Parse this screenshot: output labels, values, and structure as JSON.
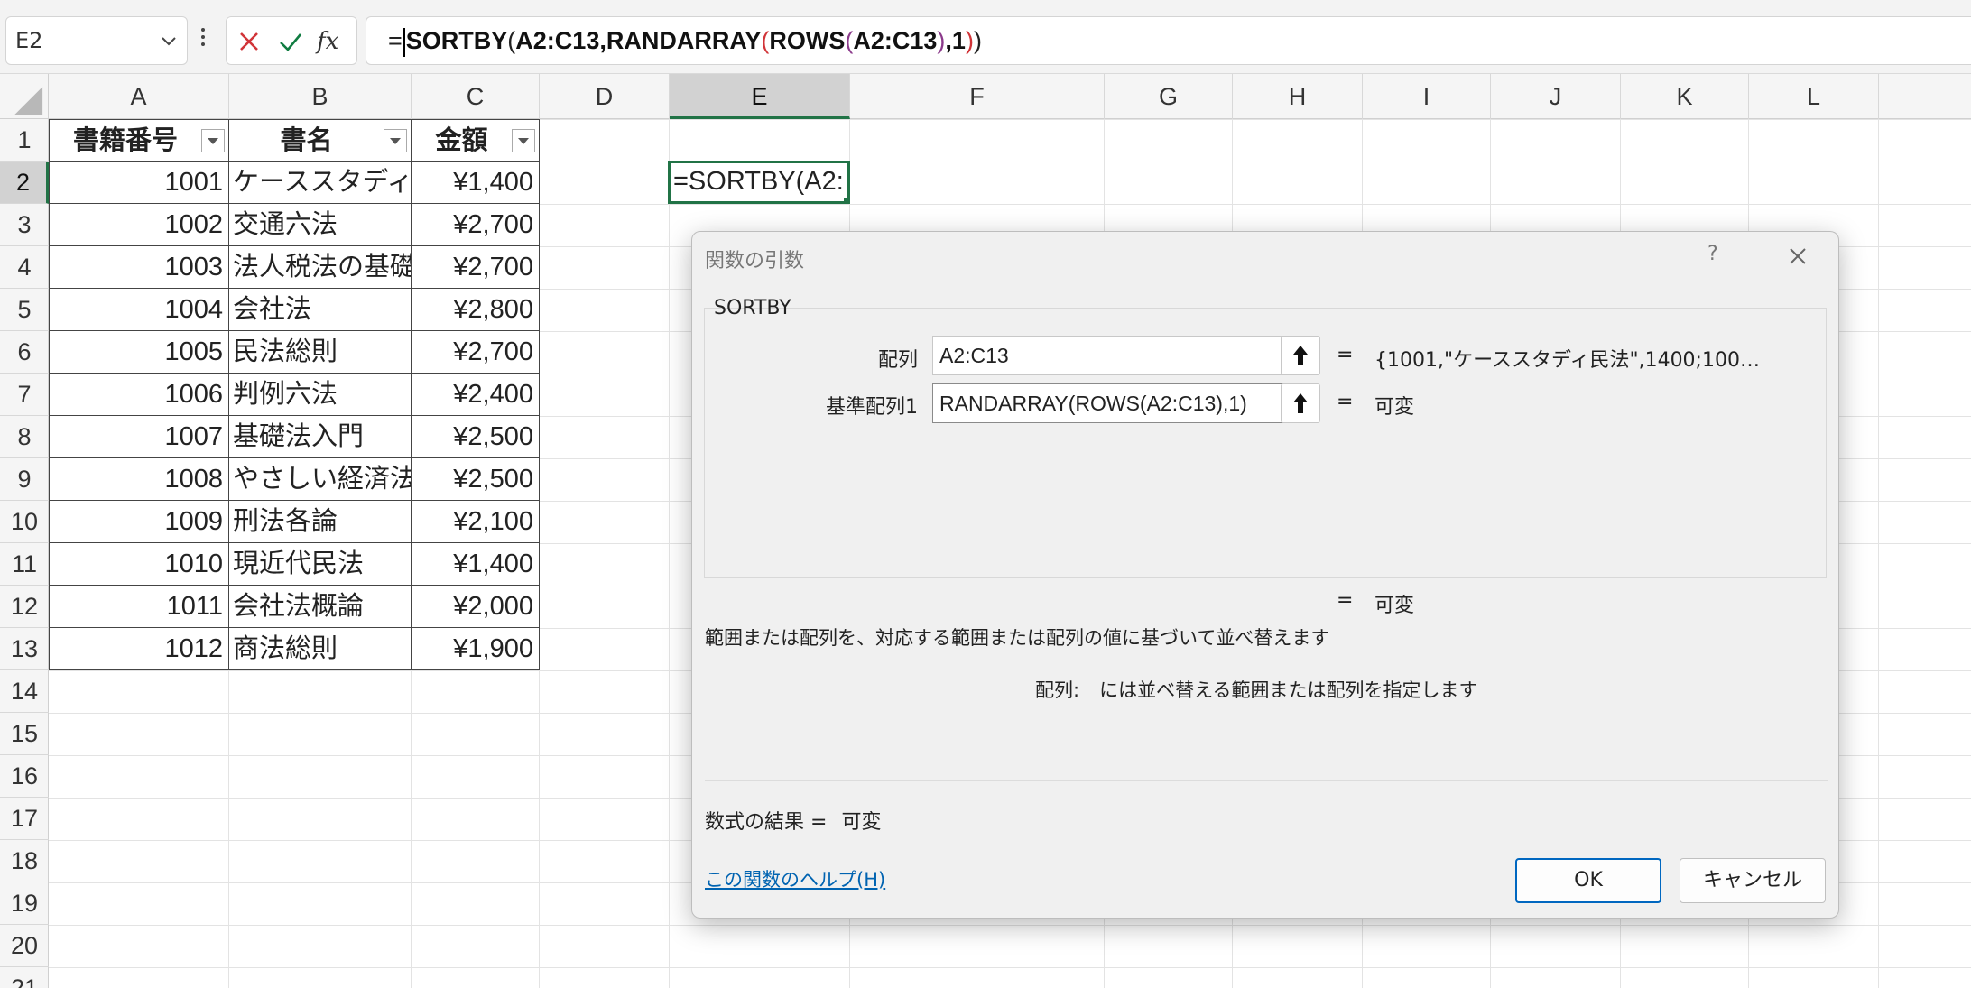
{
  "formula_bar": {
    "name_box": "E2",
    "formula_eq": "=",
    "formula_parts": [
      {
        "t": "SORTBY",
        "c": "f-strong"
      },
      {
        "t": "(",
        "c": ""
      },
      {
        "t": "A2:C13",
        "c": "f-strong"
      },
      {
        "t": ",RANDARRAY",
        "c": "f-strong"
      },
      {
        "t": "(",
        "c": "f-red"
      },
      {
        "t": "ROWS",
        "c": "f-strong"
      },
      {
        "t": "(",
        "c": "f-purple"
      },
      {
        "t": "A2:C13",
        "c": "f-strong"
      },
      {
        "t": ")",
        "c": "f-purple"
      },
      {
        "t": ",1",
        "c": "f-strong"
      },
      {
        "t": ")",
        "c": "f-red"
      },
      {
        "t": ")",
        "c": ""
      }
    ],
    "fx_label": "fx"
  },
  "grid": {
    "columns": [
      "A",
      "B",
      "C",
      "D",
      "E",
      "F",
      "G",
      "H",
      "I",
      "J",
      "K",
      "L"
    ],
    "selected_column": "E",
    "rows": [
      "1",
      "2",
      "3",
      "4",
      "5",
      "6",
      "7",
      "8",
      "9",
      "10",
      "11",
      "12",
      "13",
      "14",
      "15",
      "16",
      "17",
      "18",
      "19",
      "20",
      "21"
    ],
    "selected_row": "2",
    "table_headers": [
      "書籍番号",
      "書名",
      "金額"
    ],
    "table_rows": [
      [
        "1001",
        "ケーススタディ民法",
        "¥1,400"
      ],
      [
        "1002",
        "交通六法",
        "¥2,700"
      ],
      [
        "1003",
        "法人税法の基礎",
        "¥2,700"
      ],
      [
        "1004",
        "会社法",
        "¥2,800"
      ],
      [
        "1005",
        "民法総則",
        "¥2,700"
      ],
      [
        "1006",
        "判例六法",
        "¥2,400"
      ],
      [
        "1007",
        "基礎法入門",
        "¥2,500"
      ],
      [
        "1008",
        "やさしい経済法",
        "¥2,500"
      ],
      [
        "1009",
        "刑法各論",
        "¥2,100"
      ],
      [
        "1010",
        "現近代民法",
        "¥1,400"
      ],
      [
        "1011",
        "会社法概論",
        "¥2,000"
      ],
      [
        "1012",
        "商法総則",
        "¥1,900"
      ]
    ],
    "active_cell_text": "=SORTBY(A2:"
  },
  "dialog": {
    "title": "関数の引数",
    "help_mark": "?",
    "function_name": "SORTBY",
    "args": [
      {
        "label": "配列",
        "value": "A2:C13",
        "result": "{1001,\"ケーススタディ民法\",1400;100…"
      },
      {
        "label": "基準配列1",
        "value": "RANDARRAY(ROWS(A2:C13),1)",
        "result": "可変"
      }
    ],
    "eq_sign": "=",
    "overall_result": "可変",
    "description": "範囲または配列を、対応する範囲または配列の値に基づいて並べ替えます",
    "arg_help_name": "配列:",
    "arg_help_text": "には並べ替える範囲または配列を指定します",
    "formula_result_label": "数式の結果 =",
    "formula_result_value": "可変",
    "help_link": "この関数のヘルプ(H)",
    "ok_label": "OK",
    "cancel_label": "キャンセル"
  },
  "colors": {
    "accent_green": "#217346",
    "link_blue": "#0063b1",
    "ok_border": "#0067c0",
    "cancel_x_red": "#d13438",
    "enter_check_green": "#107c41"
  }
}
